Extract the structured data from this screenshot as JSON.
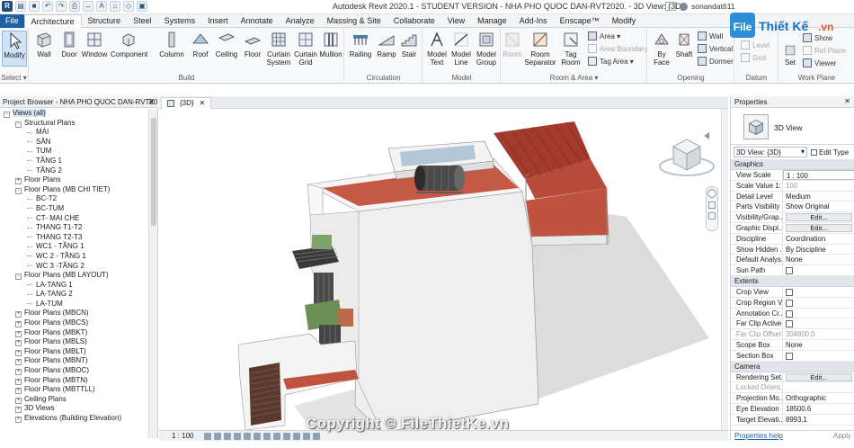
{
  "titlebar": {
    "title": "Autodesk Revit 2020.1 - STUDENT VERSION - NHA PHO QUOC DAN-RVT2020. - 3D View: {3D}",
    "user": "sonandat611"
  },
  "menu": [
    "File",
    "Architecture",
    "Structure",
    "Steel",
    "Systems",
    "Insert",
    "Annotate",
    "Analyze",
    "Massing & Site",
    "Collaborate",
    "View",
    "Manage",
    "Add-Ins",
    "Enscape™",
    "Modify"
  ],
  "ribbon": {
    "select": {
      "modify": "Modify",
      "label": "Select ▾"
    },
    "build": {
      "label": "Build",
      "buttons": [
        "Wall",
        "Door",
        "Window",
        "Component",
        "Column",
        "Roof",
        "Ceiling",
        "Floor",
        "Curtain System",
        "Curtain Grid",
        "Mullion"
      ]
    },
    "circulation": {
      "label": "Circulation",
      "buttons": [
        "Railing",
        "Ramp",
        "Stair"
      ]
    },
    "model": {
      "label": "Model",
      "buttons": [
        "Model Text",
        "Model Line",
        "Model Group"
      ]
    },
    "room_area": {
      "label": "Room & Area ▾",
      "buttons": [
        "Room",
        "Room Separator",
        "Tag Room"
      ],
      "small": [
        "Area ▾",
        "Area Boundary",
        "Tag Area ▾"
      ]
    },
    "opening": {
      "label": "Opening",
      "buttons": [
        "By Face",
        "Shaft"
      ],
      "small": [
        "Wall",
        "Vertical",
        "Dormer"
      ]
    },
    "datum": {
      "label": "Datum",
      "small": [
        "Level",
        "Grid"
      ]
    },
    "workplane": {
      "label": "Work Plane",
      "buttons": [
        "Set"
      ],
      "small": [
        "Show",
        "Ref Plane",
        "Viewer"
      ]
    }
  },
  "browser": {
    "title": "Project Browser - NHA PHO QUOC DAN-RVT20...",
    "items": [
      {
        "label": "Views (all)",
        "level": 0,
        "exp": "-"
      },
      {
        "label": "Structural Plans",
        "level": 1,
        "exp": "-"
      },
      {
        "label": "MÁI",
        "level": 2,
        "exp": ""
      },
      {
        "label": "SÂN",
        "level": 2,
        "exp": ""
      },
      {
        "label": "TUM",
        "level": 2,
        "exp": ""
      },
      {
        "label": "TẦNG 1",
        "level": 2,
        "exp": ""
      },
      {
        "label": "TẦNG 2",
        "level": 2,
        "exp": ""
      },
      {
        "label": "Floor Plans",
        "level": 1,
        "exp": "+"
      },
      {
        "label": "Floor Plans (MB CHI TIET)",
        "level": 1,
        "exp": "-"
      },
      {
        "label": "BC-T2",
        "level": 2,
        "exp": ""
      },
      {
        "label": "BC-TUM",
        "level": 2,
        "exp": ""
      },
      {
        "label": "CT- MAI CHE",
        "level": 2,
        "exp": ""
      },
      {
        "label": "THANG T1-T2",
        "level": 2,
        "exp": ""
      },
      {
        "label": "THANG T2-T3",
        "level": 2,
        "exp": ""
      },
      {
        "label": "WC1 - TẦNG 1",
        "level": 2,
        "exp": ""
      },
      {
        "label": "WC 2 - TẦNG 1",
        "level": 2,
        "exp": ""
      },
      {
        "label": "WC 3 -TẦNG 2",
        "level": 2,
        "exp": ""
      },
      {
        "label": "Floor Plans (MB LAYOUT)",
        "level": 1,
        "exp": "-"
      },
      {
        "label": "LA-TANG 1",
        "level": 2,
        "exp": ""
      },
      {
        "label": "LA-TANG 2",
        "level": 2,
        "exp": ""
      },
      {
        "label": "LA-TUM",
        "level": 2,
        "exp": ""
      },
      {
        "label": "Floor Plans (MBCN)",
        "level": 1,
        "exp": "+"
      },
      {
        "label": "Floor Plans (MBCS)",
        "level": 1,
        "exp": "+"
      },
      {
        "label": "Floor Plans (MBKT)",
        "level": 1,
        "exp": "+"
      },
      {
        "label": "Floor Plans (MBLS)",
        "level": 1,
        "exp": "+"
      },
      {
        "label": "Floor Plans (MBLT)",
        "level": 1,
        "exp": "+"
      },
      {
        "label": "Floor Plans (MBNT)",
        "level": 1,
        "exp": "+"
      },
      {
        "label": "Floor Plans (MBOC)",
        "level": 1,
        "exp": "+"
      },
      {
        "label": "Floor Plans (MBTN)",
        "level": 1,
        "exp": "+"
      },
      {
        "label": "Floor Plans (MBTTLL)",
        "level": 1,
        "exp": "+"
      },
      {
        "label": "Ceiling Plans",
        "level": 1,
        "exp": "+"
      },
      {
        "label": "3D Views",
        "level": 1,
        "exp": "+"
      },
      {
        "label": "Elevations (Building Elevation)",
        "level": 1,
        "exp": "+"
      }
    ]
  },
  "view": {
    "tab": "{3D}",
    "scale": "1 : 100"
  },
  "properties": {
    "title": "Properties",
    "type_name": "3D View",
    "type_dropdown": "3D View: {3D}",
    "edit_type": "Edit Type",
    "sections": [
      {
        "name": "Graphics",
        "rows": [
          {
            "k": "View Scale",
            "v": "1 : 100",
            "t": "input"
          },
          {
            "k": "Scale Value 1:",
            "v": "100",
            "t": "grey"
          },
          {
            "k": "Detail Level",
            "v": "Medium",
            "t": "text"
          },
          {
            "k": "Parts Visibility",
            "v": "Show Original",
            "t": "text"
          },
          {
            "k": "Visibility/Grap...",
            "v": "Edit...",
            "t": "btn"
          },
          {
            "k": "Graphic Displ...",
            "v": "Edit...",
            "t": "btn"
          },
          {
            "k": "Discipline",
            "v": "Coordination",
            "t": "text"
          },
          {
            "k": "Show Hidden ...",
            "v": "By Discipline",
            "t": "text"
          },
          {
            "k": "Default Analys...",
            "v": "None",
            "t": "text"
          },
          {
            "k": "Sun Path",
            "v": "",
            "t": "chk"
          }
        ]
      },
      {
        "name": "Extents",
        "rows": [
          {
            "k": "Crop View",
            "v": "",
            "t": "chk"
          },
          {
            "k": "Crop Region V...",
            "v": "",
            "t": "chk"
          },
          {
            "k": "Annotation Cr...",
            "v": "",
            "t": "chk"
          },
          {
            "k": "Far Clip Active",
            "v": "",
            "t": "chk"
          },
          {
            "k": "Far Clip Offset",
            "v": "304800.0",
            "t": "greyboth"
          },
          {
            "k": "Scope Box",
            "v": "None",
            "t": "text"
          },
          {
            "k": "Section Box",
            "v": "",
            "t": "chk"
          }
        ]
      },
      {
        "name": "Camera",
        "rows": [
          {
            "k": "Rendering Set...",
            "v": "Edit...",
            "t": "btn"
          },
          {
            "k": "Locked Orient...",
            "v": "",
            "t": "greyk"
          },
          {
            "k": "Projection Mo...",
            "v": "Orthographic",
            "t": "text"
          },
          {
            "k": "Eye Elevation",
            "v": "18500.6",
            "t": "text"
          },
          {
            "k": "Target Elevati...",
            "v": "8993.1",
            "t": "text"
          }
        ]
      }
    ],
    "help": "Properties help",
    "apply": "Apply"
  },
  "watermark": {
    "logo_a": "File",
    "logo_b": "Thiết Kế",
    "logo_c": ".vn",
    "copyright": "Copyright © FileThietKe.vn"
  },
  "colors": {
    "accent": "#1e5fa6",
    "roof_red": "#c0533f",
    "tile_red": "#a33a2e",
    "wall": "#efefef"
  }
}
